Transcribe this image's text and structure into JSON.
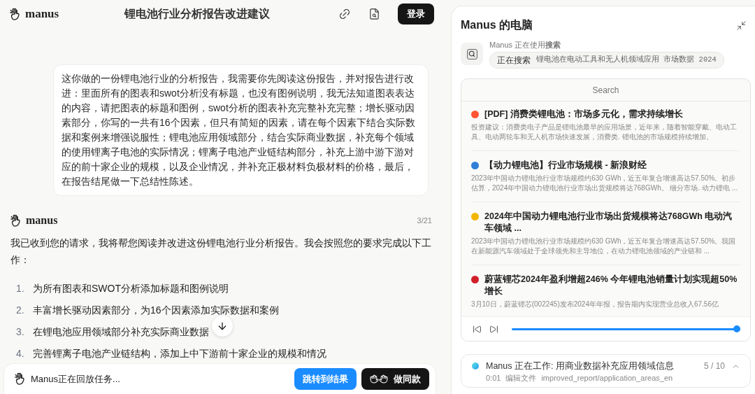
{
  "header": {
    "logo_text": "manus",
    "title": "锂电池行业分析报告改进建议",
    "login_button": "登录"
  },
  "user_message": {
    "text": "这你做的一份锂电池行业的分析报告，我需要你先阅读这份报告，并对报告进行改进：里面所有的图表和swot分析没有标题，也没有图例说明，我无法知道图表表达的内容，请把图表的标题和图例，swot分析的图表补充完整补充完整；增长驱动因素部分，你写的一共有16个因素，但只有简短的因素，请在每个因素下结合实际数据和案例来增强说服性；锂电池应用领域部分，结合实际商业数据，补充每个领域的使用锂离子电池的实际情况；锂离子电池产业链结构部分，补充上游中游下游对应的前十家企业的规模，以及企业情况，并补充正极材料负极材料的价格，最后，在报告结尾做一下总结性陈述。"
  },
  "assistant": {
    "name": "manus",
    "counter": "3/21",
    "intro": "我已收到您的请求，我将帮您阅读并改进这份锂电池行业分析报告。我会按照您的要求完成以下工作：",
    "steps": [
      {
        "number": "1.",
        "text": "为所有图表和SWOT分析添加标题和图例说明"
      },
      {
        "number": "2.",
        "text": "丰富增长驱动因素部分，为16个因素添加实际数据和案例"
      },
      {
        "number": "3.",
        "text": "在锂电池应用领域部分补充实际商业数据"
      },
      {
        "number": "4.",
        "text": "完善锂离子电池产业链结构，添加上中下游前十家企业的规模和情况"
      }
    ]
  },
  "replay_bar": {
    "status": "Manus正在回放任务...",
    "buttons": [
      {
        "label": "跳转到结果",
        "kind": "primary"
      },
      {
        "label": "做同款",
        "kind": "dark"
      }
    ]
  },
  "computer_panel": {
    "title": "Manus 的电脑",
    "tool_status": "Manus 正在使用**搜索**",
    "action_label": "正在搜索",
    "query": "锂电池在电动工具和无人机领域应用 市场数据 2024",
    "browser": {
      "title": "Search",
      "results": [
        {
          "title": "[PDF] 消费类锂电池：市场多元化，需求持续增长",
          "snippet": "投资建议：消费类电子产品是锂电池最早的应用场景，近年来，随着智能穿戴、电动工具、电动两轮车和无人机市场快速发展，消费类. 锂电池的市场规模持续增加。",
          "color": "#ff5533"
        },
        {
          "title": "【动力锂电池】行业市场规模 - 新浪财经",
          "snippet": "2023年中国动力锂电池行业市场规模约630 GWh，近五年复合增速高达57.50%。初步估算，2024年中国动力锂电池行业市场出货规模将达768GWh。 细分市场. 动力锂电 ...",
          "color": "#2f7fd8"
        },
        {
          "title": "2024年中国动力锂电池行业市场出货规模将达768GWh 电动汽车领域 ...",
          "snippet": "2023年中国动力锂电池行业市场规模约630 GWh，近五年复合增速高达57.50%。我国在新能源汽车领域处于全球领先和主导地位，在动力锂电池领域的产业链和 ...",
          "color": "#f2b600"
        },
        {
          "title": "蔚蓝锂芯2024年盈利增超246% 今年锂电池销量计划实现超50%增长",
          "snippet": "3月10日，蔚蓝锂芯(002245)发布2024年年报，报告期内实现营业总收入67.56亿",
          "color": "#d11f2a"
        }
      ]
    },
    "player": {
      "level": 1
    }
  },
  "task_status": {
    "title": "Manus 正在工作: 用商业数据补充应用领域信息",
    "step_count": "5 / 10",
    "time": "0:01",
    "action": "编辑文件",
    "file": "improved_report/application_areas_en"
  }
}
